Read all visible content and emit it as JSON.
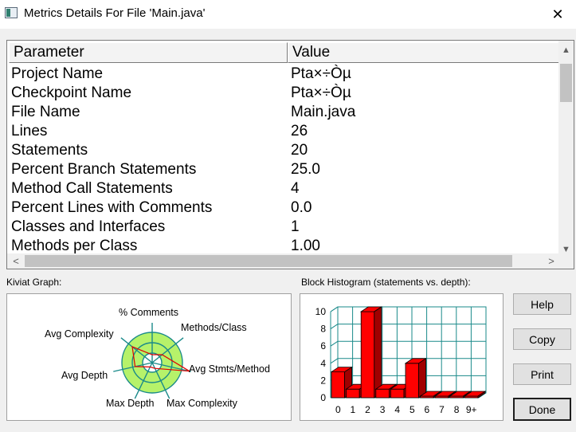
{
  "window": {
    "title": "Metrics Details For File 'Main.java'",
    "icon": "window-app-icon",
    "close_icon": "close-icon"
  },
  "table": {
    "columns": [
      "Parameter",
      "Value"
    ],
    "rows": [
      {
        "parameter": "Project Name",
        "value": "Pta×÷Òµ"
      },
      {
        "parameter": "Checkpoint Name",
        "value": "Pta×÷Òµ"
      },
      {
        "parameter": "File Name",
        "value": "Main.java"
      },
      {
        "parameter": "Lines",
        "value": "26"
      },
      {
        "parameter": "Statements",
        "value": "20"
      },
      {
        "parameter": "Percent Branch Statements",
        "value": "25.0"
      },
      {
        "parameter": "Method Call Statements",
        "value": "4"
      },
      {
        "parameter": "Percent Lines with Comments",
        "value": "0.0"
      },
      {
        "parameter": "Classes and Interfaces",
        "value": "1"
      },
      {
        "parameter": "Methods per Class",
        "value": "1.00"
      }
    ]
  },
  "kiviat": {
    "label": "Kiviat Graph:",
    "axes": [
      "% Comments",
      "Methods/Class",
      "Avg Stmts/Method",
      "Max Complexity",
      "Max Depth",
      "Avg Depth",
      "Avg Complexity"
    ],
    "colors": {
      "ring_fill": "#b6f26a",
      "ring_stroke": "#1a8a8a",
      "plot": "#e00000"
    }
  },
  "histogram": {
    "label": "Block Histogram (statements vs. depth):",
    "colors": {
      "bar": "#ff0000",
      "bar_dark": "#a00000",
      "grid": "#1a8a8a"
    }
  },
  "chart_data": {
    "type": "bar",
    "categories": [
      "0",
      "1",
      "2",
      "3",
      "4",
      "5",
      "6",
      "7",
      "8",
      "9+"
    ],
    "values": [
      3,
      1,
      10,
      1,
      1,
      4,
      0,
      0,
      0,
      0
    ],
    "ylim": [
      0,
      10
    ],
    "yticks": [
      0,
      2,
      4,
      6,
      8,
      10
    ],
    "grid": true
  },
  "buttons": {
    "help": "Help",
    "copy": "Copy",
    "print": "Print",
    "done": "Done"
  }
}
